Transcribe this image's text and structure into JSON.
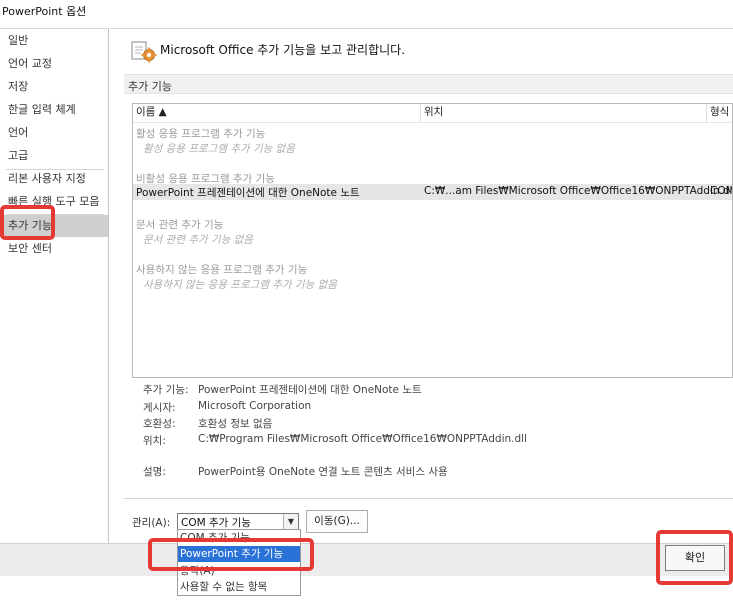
{
  "window": {
    "title": "PowerPoint 옵션"
  },
  "sidebar": {
    "items": [
      {
        "label": "일반"
      },
      {
        "label": "언어 교정"
      },
      {
        "label": "저장"
      },
      {
        "label": "한글 입력 체계"
      },
      {
        "label": "언어"
      },
      {
        "label": "고급"
      },
      {
        "label": "리본 사용자 지정"
      },
      {
        "label": "빠른 실행 도구 모음"
      },
      {
        "label": "추가 기능",
        "selected": true
      },
      {
        "label": "보안 센터"
      }
    ]
  },
  "header": {
    "text": "Microsoft Office 추가 기능을 보고 관리합니다.",
    "icon": "addin-gear-icon"
  },
  "section": {
    "title": "추가 기능"
  },
  "list": {
    "columns": [
      "이름 ▲",
      "위치",
      "형식"
    ],
    "groups": [
      {
        "title": "활성 응용 프로그램 추가 기능",
        "empty": "활성 응용 프로그램 추가 기능 없음"
      },
      {
        "title": "비활성 응용 프로그램 추가 기능"
      },
      {
        "title": "문서 관련 추가 기능",
        "empty": "문서 관련 추가 기능 없음"
      },
      {
        "title": "사용하지 않는 응용 프로그램 추가 기능",
        "empty": "사용하지 않는 응용 프로그램 추가 기능 없음"
      }
    ],
    "row": {
      "name": "PowerPoint 프레젠테이션에 대한 OneNote 노트",
      "location": "C:₩...am Files₩Microsoft Office₩Office16₩ONPPTAddin.dll",
      "type": "COM"
    }
  },
  "details": {
    "addin_label": "추가 기능:",
    "addin_value": "PowerPoint 프레젠테이션에 대한 OneNote 노트",
    "publisher_label": "게시자:",
    "publisher_value": "Microsoft Corporation",
    "compat_label": "호환성:",
    "compat_value": "호환성 정보 없음",
    "location_label": "위치:",
    "location_value": "C:₩Program Files₩Microsoft Office₩Office16₩ONPPTAddin.dll",
    "desc_label": "설명:",
    "desc_value": "PowerPoint용 OneNote 연결 노트 콘텐츠 서비스 사용"
  },
  "manage": {
    "label": "관리(A):",
    "selected": "COM 추가 기능",
    "go_button": "이동(G)...",
    "options": [
      "COM 추가 기능",
      "PowerPoint 추가 기능",
      "동작(A)",
      "사용할 수 없는 항목"
    ],
    "highlighted_option": "PowerPoint 추가 기능"
  },
  "footer": {
    "ok_button": "확인"
  },
  "colors": {
    "highlight_red": "#e53935",
    "selection_blue": "#2b72d8",
    "selected_nav": "#cfcfcf"
  }
}
